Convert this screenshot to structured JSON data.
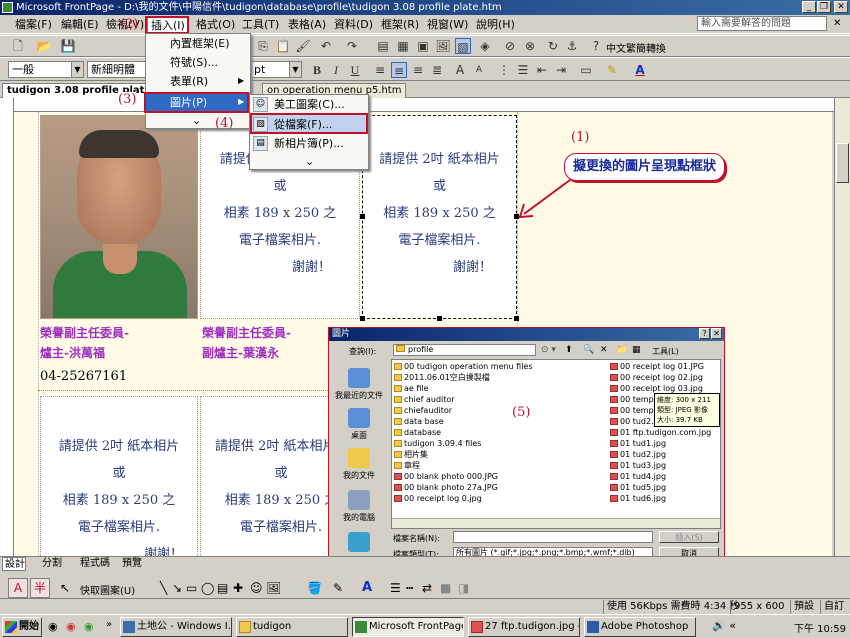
{
  "window": {
    "title": "Microsoft FrontPage - D:\\我的文件\\中陽信件\\tudigon\\database\\profile\\tudigon 3.08 profile plate.htm",
    "minimize": "_",
    "restore": "❐",
    "close": "✕"
  },
  "menubar": {
    "items": [
      "檔案(F)",
      "編輯(E)",
      "檢視(V)",
      "插入(I)",
      "格式(O)",
      "工具(T)",
      "表格(A)",
      "資料(D)",
      "框架(R)",
      "視窗(W)",
      "說明(H)"
    ],
    "help_placeholder": "輸入需要解答的問題"
  },
  "toolbar": {
    "style_combo": "一般",
    "font_combo": "新細明體",
    "size_combo": "pt",
    "language_button": "中文繁簡轉換",
    "bold": "B",
    "italic": "I",
    "underline": "U"
  },
  "doc_tabs": [
    "tudigon 3.08 profile plate.htm",
    "on operation menu p5.htm"
  ],
  "insert_menu": {
    "items": [
      "內置框架(E)",
      "符號(S)...",
      "表單(R)",
      "圖片(P)",
      "⌄"
    ]
  },
  "picture_submenu": {
    "items": [
      "美工圖案(C)...",
      "從檔案(F)...",
      "新相片簿(P)...",
      "⌄"
    ]
  },
  "annotations": {
    "a1": "(1)",
    "a1_text": "擬更換的圖片呈現點框狀",
    "a2": "(2)",
    "a3": "(3)",
    "a4": "(4)",
    "a5": "(5)"
  },
  "document": {
    "placeholder_lines": [
      "請提供 2吋 紙本相片",
      "或",
      "相素 189 x 250 之",
      "電子檔案相片.",
      "謝謝！"
    ],
    "person1_title": "榮譽副主任委員-",
    "person1_name": "爐主-洪萬福",
    "person2_title": "榮譽副主任委員-",
    "person2_name": "副爐主-葉漢永",
    "phone": "04-25267161"
  },
  "dialog": {
    "title": "圖片",
    "help": "?",
    "close": "✕",
    "lookin_label": "查詢(I):",
    "lookin_value": "profile",
    "tools_label": "工具(L)",
    "places": [
      "我最近的文件",
      "桌面",
      "我的文件",
      "我的電腦",
      ""
    ],
    "files_left": [
      "00 tudigon operation menu files",
      "2011.06.01空白撲製檔",
      "ae file",
      "chief auditor",
      "chiefauditor",
      "data base",
      "database",
      "tudigon 3.09.4 files",
      "相片集",
      "章程",
      "00 blank photo 000.JPG",
      "00 blank photo 27a.JPG",
      "00 receipt log 0.jpg"
    ],
    "files_right": [
      "00 receipt log 01.JPG",
      "00 receipt log 02.jpg",
      "00 receipt log 03.jpg",
      "00 temple o",
      "00 temple o",
      "00 tud2.jpg",
      "01 ftp.tudigon.com.jpg",
      "01 tud1.jpg",
      "01 tud2.jpg",
      "01 tud3.jpg",
      "01 tud4.jpg",
      "01 tud5.jpg",
      "01 tud6.jpg"
    ],
    "tooltip": [
      "維度: 300 x 211",
      "類型: JPEG 影像",
      "大小: 39.7 KB"
    ],
    "filename_label": "檔案名稱(N):",
    "filetype_label": "檔案類型(T):",
    "filetype_value": "所有圖片 (*.gif;*.jpg;*.png;*.bmp;*.wmf;*.dib)",
    "insert_button": "插入(S)",
    "cancel_button": "取消"
  },
  "view_tabs": [
    "設計",
    "分割",
    "程式碼",
    "預覽"
  ],
  "drawbar": {
    "autoshapes": "快取圖案(U)"
  },
  "statusbar": {
    "connection": "使用 56Kbps 需費時 4:34 秒",
    "size": "955 x 600",
    "mode": "預設",
    "custom": "自訂"
  },
  "taskbar": {
    "start": "開始",
    "tasks": [
      "土地公 - Windows I...",
      "tudigon",
      "Microsoft FrontPage ...",
      "27 ftp.tudigon.jpg - ...",
      "Adobe Photoshop"
    ],
    "clock": "下午 10:59"
  },
  "colors": {
    "titlebar": "#0a246a",
    "accent_red": "#c0102a",
    "name_purple": "#a030c0",
    "placeholder_blue": "#2a3b7c",
    "cream": "#fffbe6"
  }
}
